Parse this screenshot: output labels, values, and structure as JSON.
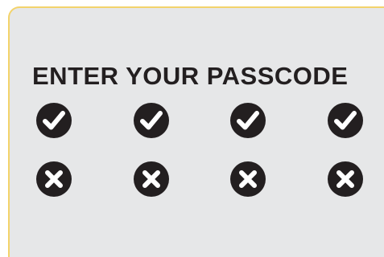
{
  "prompt": {
    "title": "ENTER YOUR PASSCODE"
  },
  "icon_rows": {
    "check_row": [
      "check-icon",
      "check-icon",
      "check-icon",
      "check-icon"
    ],
    "cross_row": [
      "close-icon",
      "close-icon",
      "close-icon",
      "close-icon"
    ]
  },
  "colors": {
    "background": "#e6e7e8",
    "border": "#f3d36b",
    "text": "#231f20",
    "icon": "#231f20",
    "icon_mark": "#ffffff"
  }
}
